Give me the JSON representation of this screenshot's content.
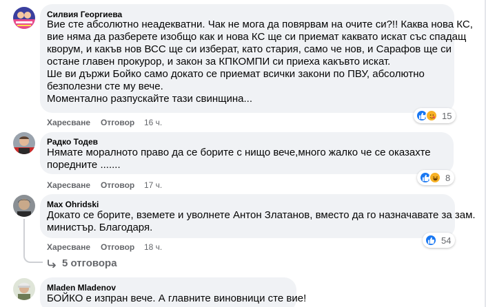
{
  "comments": [
    {
      "author": "Силвия Георгиева",
      "lines": [
        "Вие сте абсолютно неадекватни. Чак не мога да повярвам на очите си?!! Каква нова КС,",
        "вие няма да разберете изобщо как и нова КС ще си приемат каквато искат със спадащ",
        "кворум, и какъв нов ВСС ще си изберат, като стария, само че нов, и Сарафов ще си",
        "остане главен прокурор, и закон за КПКОМПИ си приеха какъвто искат.",
        "Ше ви държи Бойко само докато се приемат всички закони по ПВУ, абсолютно",
        "безполезни сте му вече.",
        "Моментално разпускайте тази свинщина..."
      ],
      "like_label": "Харесване",
      "reply_label": "Отговор",
      "time": "16 ч.",
      "reaction_count": "15",
      "reactions": [
        "like-icon",
        "care-icon"
      ]
    },
    {
      "author": "Радко Тодев",
      "lines": [
        "Нямате моралното право да се борите с нищо вече,много жалко че се оказахте",
        "поредните ......."
      ],
      "like_label": "Харесване",
      "reply_label": "Отговор",
      "time": "17 ч.",
      "reaction_count": "8",
      "reactions": [
        "like-icon",
        "haha-icon"
      ]
    },
    {
      "author": "Max Ohridski",
      "lines": [
        "Докато се борите, вземете и уволнете Антон Златанов, вместо да го назначавате за зам.",
        "министър. Благодаря."
      ],
      "like_label": "Харесване",
      "reply_label": "Отговор",
      "time": "18 ч.",
      "reaction_count": "54",
      "reactions": [
        "like-icon"
      ],
      "replies_label": "5 отговора"
    },
    {
      "author": "Mladen Mladenov",
      "lines": [
        "БОЙКО е изпран вече. А главните виновници сте вие!"
      ]
    }
  ],
  "colors": {
    "bubble": "#f0f2f5",
    "like_blue": "#1877f2",
    "care_yellow": "#f7b125",
    "muted": "#65676b"
  }
}
